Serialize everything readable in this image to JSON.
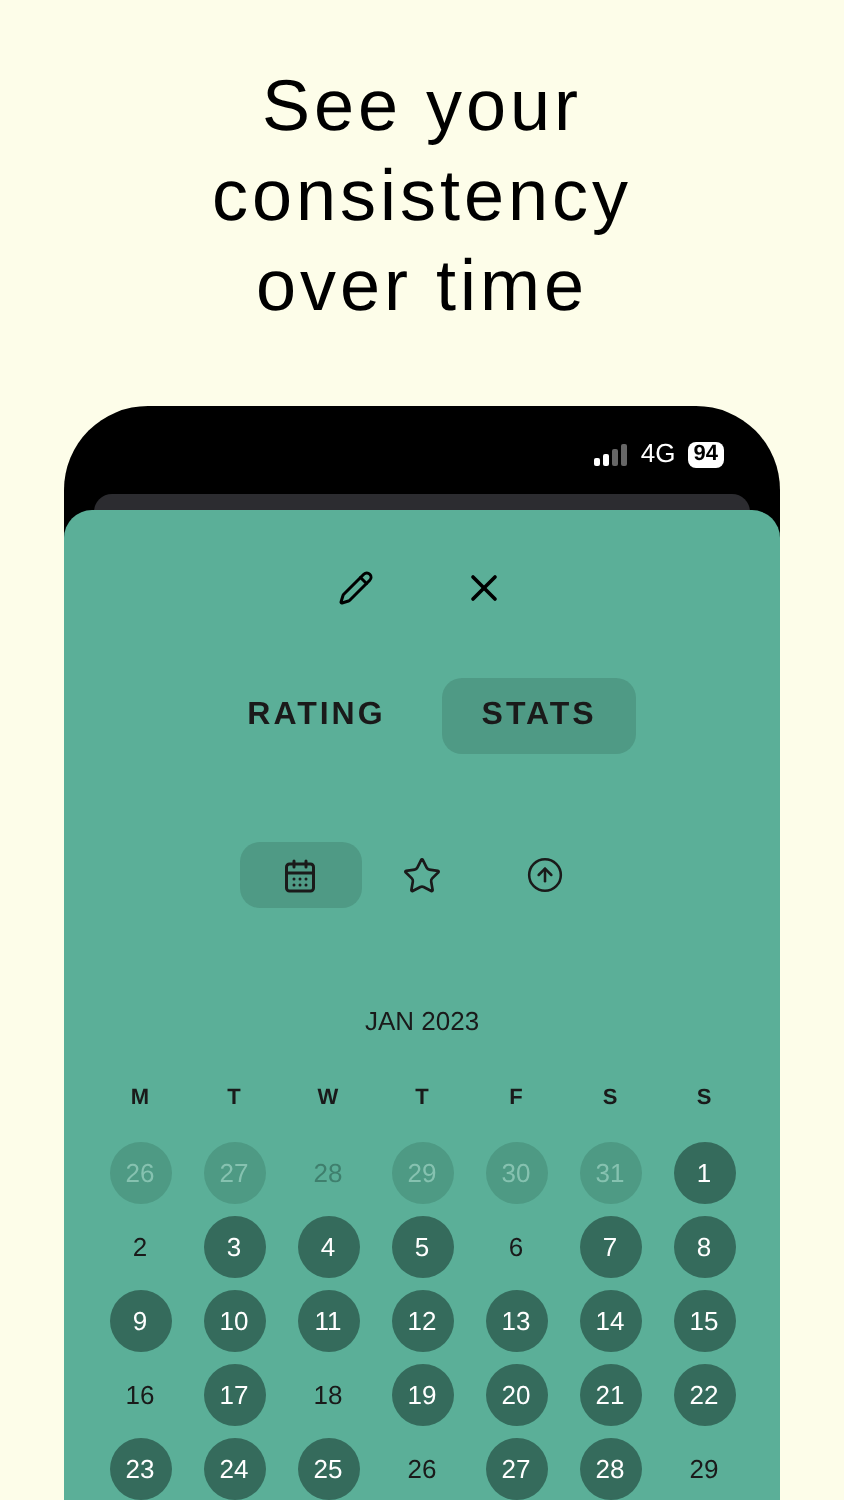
{
  "headline": "See your consistency over time",
  "status_bar": {
    "network": "4G",
    "battery": "94"
  },
  "tabs": [
    {
      "label": "RATING",
      "selected": false
    },
    {
      "label": "STATS",
      "selected": true
    }
  ],
  "view_tabs": [
    {
      "kind": "calendar",
      "selected": true
    },
    {
      "kind": "star",
      "selected": false
    },
    {
      "kind": "upload",
      "selected": false
    }
  ],
  "calendar": {
    "month": "JAN 2023",
    "weekdays": [
      "M",
      "T",
      "W",
      "T",
      "F",
      "S",
      "S"
    ],
    "days": [
      {
        "label": "26",
        "in_month": false,
        "logged": true
      },
      {
        "label": "27",
        "in_month": false,
        "logged": true
      },
      {
        "label": "28",
        "in_month": false,
        "logged": false
      },
      {
        "label": "29",
        "in_month": false,
        "logged": true
      },
      {
        "label": "30",
        "in_month": false,
        "logged": true
      },
      {
        "label": "31",
        "in_month": false,
        "logged": true
      },
      {
        "label": "1",
        "in_month": true,
        "logged": true
      },
      {
        "label": "2",
        "in_month": true,
        "logged": false
      },
      {
        "label": "3",
        "in_month": true,
        "logged": true
      },
      {
        "label": "4",
        "in_month": true,
        "logged": true
      },
      {
        "label": "5",
        "in_month": true,
        "logged": true
      },
      {
        "label": "6",
        "in_month": true,
        "logged": false
      },
      {
        "label": "7",
        "in_month": true,
        "logged": true
      },
      {
        "label": "8",
        "in_month": true,
        "logged": true
      },
      {
        "label": "9",
        "in_month": true,
        "logged": true
      },
      {
        "label": "10",
        "in_month": true,
        "logged": true
      },
      {
        "label": "11",
        "in_month": true,
        "logged": true
      },
      {
        "label": "12",
        "in_month": true,
        "logged": true
      },
      {
        "label": "13",
        "in_month": true,
        "logged": true
      },
      {
        "label": "14",
        "in_month": true,
        "logged": true
      },
      {
        "label": "15",
        "in_month": true,
        "logged": true
      },
      {
        "label": "16",
        "in_month": true,
        "logged": false
      },
      {
        "label": "17",
        "in_month": true,
        "logged": true
      },
      {
        "label": "18",
        "in_month": true,
        "logged": false
      },
      {
        "label": "19",
        "in_month": true,
        "logged": true
      },
      {
        "label": "20",
        "in_month": true,
        "logged": true
      },
      {
        "label": "21",
        "in_month": true,
        "logged": true
      },
      {
        "label": "22",
        "in_month": true,
        "logged": true
      },
      {
        "label": "23",
        "in_month": true,
        "logged": true
      },
      {
        "label": "24",
        "in_month": true,
        "logged": true
      },
      {
        "label": "25",
        "in_month": true,
        "logged": true
      },
      {
        "label": "26",
        "in_month": true,
        "logged": false
      },
      {
        "label": "27",
        "in_month": true,
        "logged": true
      },
      {
        "label": "28",
        "in_month": true,
        "logged": true
      },
      {
        "label": "29",
        "in_month": true,
        "logged": false
      }
    ]
  }
}
